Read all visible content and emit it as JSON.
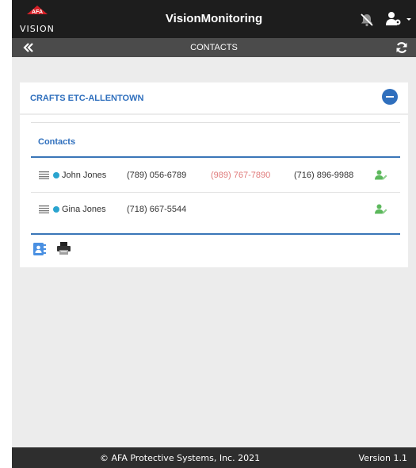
{
  "header": {
    "logo_badge": "AFA",
    "logo_text": "VISION",
    "title": "VisionMonitoring",
    "icons": {
      "notifications": "bell-slash-icon",
      "user_menu": "user-gear-icon"
    }
  },
  "subheader": {
    "title": "CONTACTS",
    "back_icon": "double-chevron-left-icon",
    "refresh_icon": "refresh-icon"
  },
  "site": {
    "name": "CRAFTS ETC-ALLENTOWN",
    "collapse_icon": "minus-circle-icon"
  },
  "contacts": {
    "header": "Contacts",
    "rows": [
      {
        "name": "John Jones",
        "phone1": "(789) 056-6789",
        "phone2": "(989) 767-7890",
        "phone3": "(716) 896-9988"
      },
      {
        "name": "Gina Jones",
        "phone1": "(718) 667-5544",
        "phone2": "",
        "phone3": ""
      }
    ],
    "tool_icons": [
      "contact-book-icon",
      "printer-icon"
    ]
  },
  "footer": {
    "copyright": "© AFA Protective Systems, Inc. 2021",
    "version": "Version 1.1"
  },
  "colors": {
    "header_bg": "#1d1d1d",
    "subheader_bg": "#4b4b4b",
    "accent_blue": "#2f6fbd",
    "status_dot": "#2aa4cf",
    "alt_phone": "#e07b7b",
    "edit_icon": "#5cb85c",
    "logo_red": "#d62027"
  }
}
